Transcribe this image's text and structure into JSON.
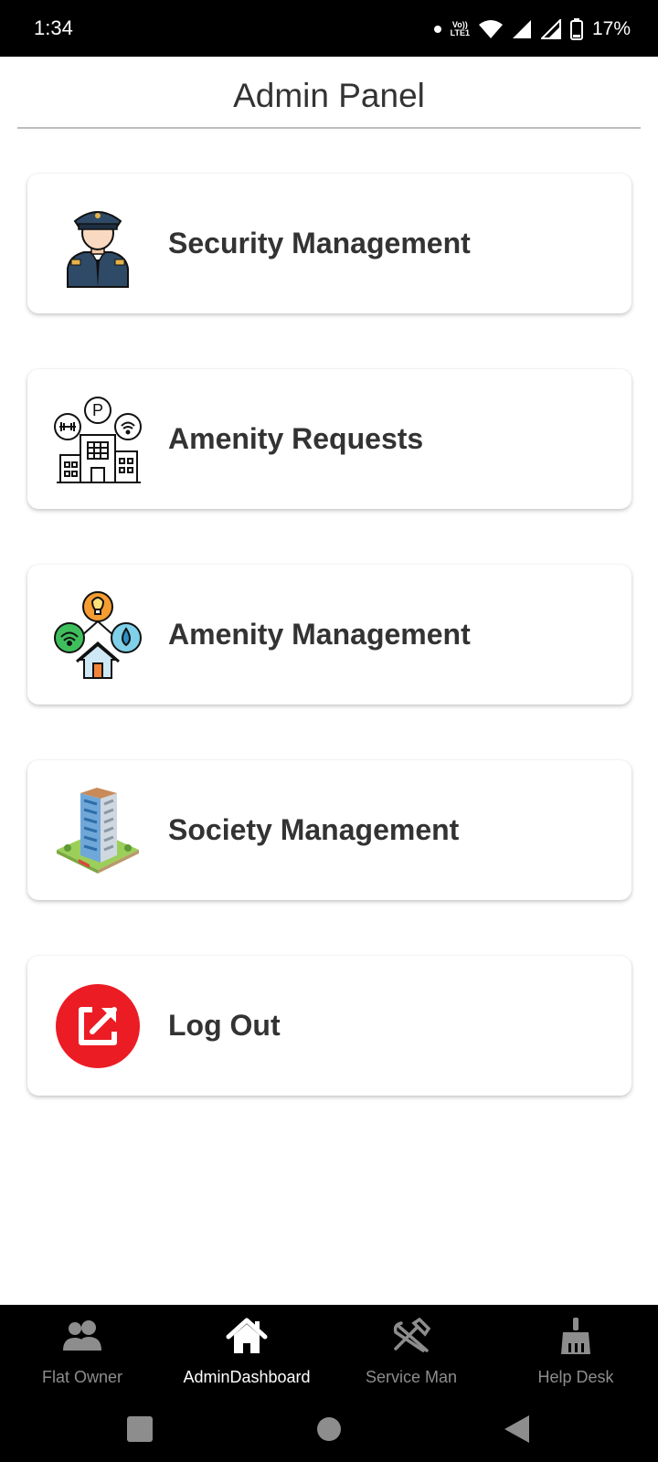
{
  "status_bar": {
    "time": "1:34",
    "volte_line1": "Vo))",
    "volte_line2": "LTE1",
    "battery_pct": "17%"
  },
  "header": {
    "title": "Admin Panel"
  },
  "menu": {
    "items": [
      {
        "label": "Security Management",
        "icon": "security-guard-icon"
      },
      {
        "label": "Amenity Requests",
        "icon": "amenity-building-icon"
      },
      {
        "label": "Amenity Management",
        "icon": "utilities-icon"
      },
      {
        "label": "Society Management",
        "icon": "tower-building-icon"
      },
      {
        "label": "Log Out",
        "icon": "logout-icon",
        "accent": "#ec1c24"
      }
    ]
  },
  "bottom_nav": {
    "items": [
      {
        "label": "Flat Owner",
        "icon": "people-icon"
      },
      {
        "label": "AdminDashboard",
        "icon": "home-icon",
        "active": true
      },
      {
        "label": "Service Man",
        "icon": "tools-icon"
      },
      {
        "label": "Help Desk",
        "icon": "broom-icon"
      }
    ]
  },
  "colors": {
    "text": "#333333",
    "nav_background": "#000000",
    "nav_inactive": "#8d8d8d",
    "nav_active": "#ffffff",
    "logout_red": "#ec1c24"
  }
}
